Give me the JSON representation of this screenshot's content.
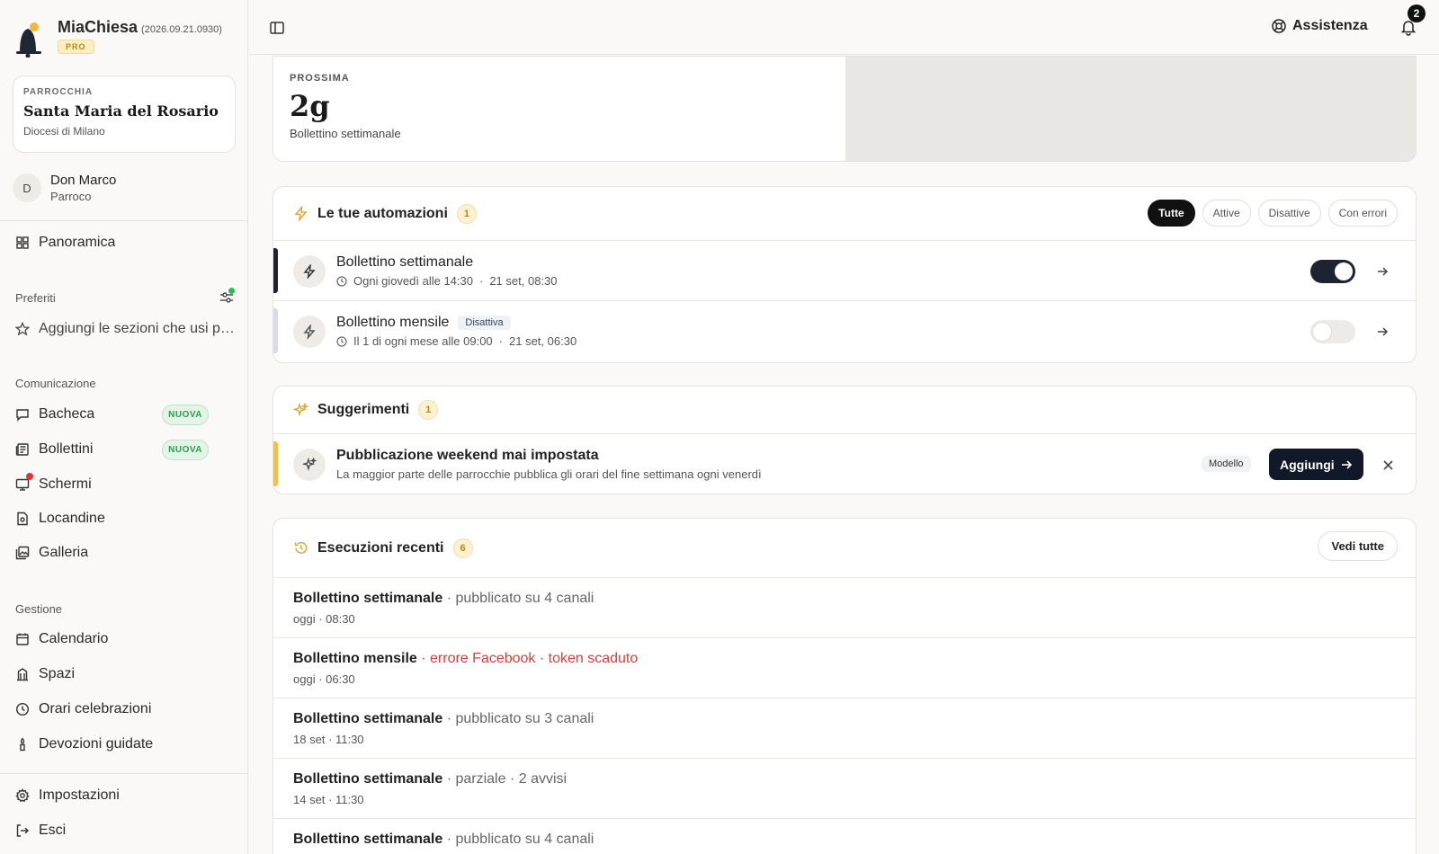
{
  "app": {
    "name": "MiaChiesa",
    "version": "(2026.09.21.0930)",
    "plan": "PRO"
  },
  "parish": {
    "label": "PARROCCHIA",
    "name": "Santa Maria del Rosario",
    "diocese": "Diocesi di Milano"
  },
  "user": {
    "initial": "D",
    "name": "Don Marco",
    "role": "Parroco"
  },
  "nav": {
    "overview": "Panoramica",
    "favorites_label": "Preferiti",
    "favorites_hint": "Aggiungi le sezioni che usi più spesso",
    "communication_label": "Comunicazione",
    "communication": [
      {
        "label": "Bacheca",
        "badge": "NUOVA"
      },
      {
        "label": "Bollettini",
        "badge": "NUOVA"
      },
      {
        "label": "Schermi",
        "badge": ""
      },
      {
        "label": "Locandine",
        "badge": ""
      },
      {
        "label": "Galleria",
        "badge": ""
      }
    ],
    "management_label": "Gestione",
    "management": [
      {
        "label": "Calendario"
      },
      {
        "label": "Spazi"
      },
      {
        "label": "Orari celebrazioni"
      },
      {
        "label": "Devozioni guidate"
      }
    ],
    "settings": "Impostazioni",
    "logout": "Esci"
  },
  "topbar": {
    "help": "Assistenza",
    "notifications": "2"
  },
  "next": {
    "label": "PROSSIMA",
    "value": "2g",
    "subtitle": "Bollettino settimanale"
  },
  "automations": {
    "title": "Le tue automazioni",
    "count": "1",
    "filters": [
      "Tutte",
      "Attive",
      "Disattive",
      "Con errori"
    ],
    "active_filter": "Tutte",
    "items": [
      {
        "title": "Bollettino settimanale",
        "tag": "",
        "schedule": "Ogni giovedì alle 14:30",
        "last": "21 set, 08:30",
        "enabled": true,
        "accent": "#1d2330"
      },
      {
        "title": "Bollettino mensile",
        "tag": "Disattiva",
        "schedule": "Il 1 di ogni mese alle 09:00",
        "last": "21 set, 06:30",
        "enabled": false,
        "accent": "#d5dce8"
      }
    ]
  },
  "suggestions": {
    "title": "Suggerimenti",
    "count": "1",
    "items": [
      {
        "title": "Pubblicazione weekend mai impostata",
        "description": "La maggior parte delle parrocchie pubblica gli orari del fine settimana ogni venerdì",
        "model_label": "Modello",
        "add_label": "Aggiungi",
        "accent": "#f0bf52"
      }
    ]
  },
  "executions": {
    "title": "Esecuzioni recenti",
    "count": "6",
    "see_all": "Vedi tutte",
    "items": [
      {
        "name": "Bollettino settimanale",
        "detail": " · pubblicato su 4 canali",
        "error": false,
        "time": "oggi · 08:30"
      },
      {
        "name": "Bollettino mensile",
        "detail": " · errore Facebook · token scaduto",
        "error": true,
        "time": "oggi · 06:30"
      },
      {
        "name": "Bollettino settimanale",
        "detail": " · pubblicato su 3 canali",
        "error": false,
        "time": "18 set · 11:30"
      },
      {
        "name": "Bollettino settimanale",
        "detail": " · parziale · 2 avvisi",
        "error": false,
        "time": "14 set · 11:30"
      },
      {
        "name": "Bollettino settimanale",
        "detail": " · pubblicato su 4 canali",
        "error": false,
        "time": ""
      }
    ]
  }
}
